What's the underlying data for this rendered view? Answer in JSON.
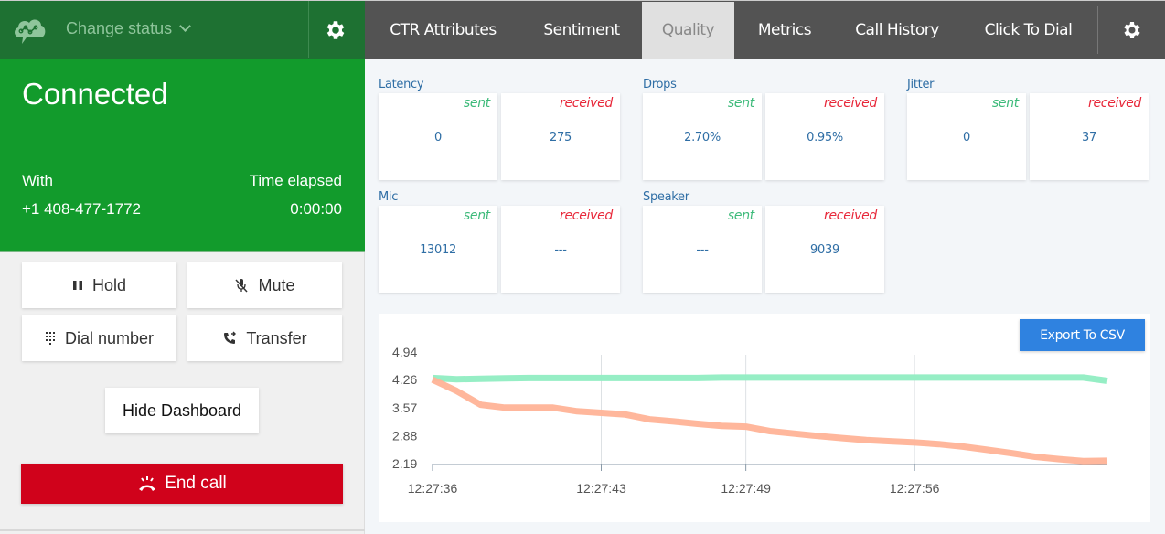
{
  "left": {
    "status_dropdown": "Change status",
    "connection": {
      "title": "Connected",
      "with_label": "With",
      "phone": "+1 408-477-1772",
      "elapsed_label": "Time elapsed",
      "elapsed": "0:00:00"
    },
    "buttons": {
      "hold": "Hold",
      "mute": "Mute",
      "dial": "Dial number",
      "transfer": "Transfer",
      "hide_dashboard": "Hide Dashboard",
      "end_call": "End call"
    },
    "colors": {
      "header": "#1e7132",
      "connected": "#129b2c",
      "end_call": "#d0021b"
    }
  },
  "tabs": [
    {
      "label": "CTR Attributes",
      "active": false
    },
    {
      "label": "Sentiment",
      "active": false
    },
    {
      "label": "Quality",
      "active": true
    },
    {
      "label": "Metrics",
      "active": false
    },
    {
      "label": "Call History",
      "active": false
    },
    {
      "label": "Click To Dial",
      "active": false
    }
  ],
  "metrics": {
    "sent_label": "sent",
    "received_label": "received",
    "groups": [
      {
        "title": "Latency",
        "sent": "0",
        "received": "275"
      },
      {
        "title": "Drops",
        "sent": "2.70%",
        "received": "0.95%"
      },
      {
        "title": "Jitter",
        "sent": "0",
        "received": "37"
      },
      {
        "title": "Mic",
        "sent": "13012",
        "received": "---"
      },
      {
        "title": "Speaker",
        "sent": "---",
        "received": "9039"
      }
    ]
  },
  "export_button": "Export To CSV",
  "chart_data": {
    "type": "line",
    "title": "",
    "xlabel": "",
    "ylabel": "",
    "ylim": [
      2.19,
      4.94
    ],
    "yticks": [
      "4.94",
      "4.26",
      "3.57",
      "2.88",
      "2.19"
    ],
    "xticks": [
      "12:27:36",
      "12:27:43",
      "12:27:49",
      "12:27:56"
    ],
    "x": [
      "12:27:36",
      "12:27:37",
      "12:27:38",
      "12:27:39",
      "12:27:40",
      "12:27:41",
      "12:27:42",
      "12:27:43",
      "12:27:44",
      "12:27:45",
      "12:27:46",
      "12:27:47",
      "12:27:48",
      "12:27:49",
      "12:27:50",
      "12:27:51",
      "12:27:52",
      "12:27:53",
      "12:27:54",
      "12:27:55",
      "12:27:56",
      "12:27:57",
      "12:27:58",
      "12:27:59",
      "12:28:00",
      "12:28:01",
      "12:28:02",
      "12:28:03",
      "12:28:04"
    ],
    "grid": "vertical",
    "legend": "none",
    "series": [
      {
        "name": "sent",
        "color": "#90edc2",
        "values": [
          4.3,
          4.27,
          4.28,
          4.29,
          4.3,
          4.3,
          4.3,
          4.3,
          4.3,
          4.3,
          4.3,
          4.3,
          4.31,
          4.31,
          4.31,
          4.31,
          4.31,
          4.31,
          4.31,
          4.31,
          4.31,
          4.31,
          4.31,
          4.31,
          4.31,
          4.31,
          4.31,
          4.31,
          4.23
        ]
      },
      {
        "name": "received",
        "color": "#ffb397",
        "values": [
          4.26,
          3.98,
          3.64,
          3.57,
          3.57,
          3.57,
          3.48,
          3.44,
          3.4,
          3.28,
          3.23,
          3.17,
          3.12,
          3.1,
          2.99,
          2.93,
          2.87,
          2.82,
          2.77,
          2.74,
          2.71,
          2.67,
          2.61,
          2.53,
          2.45,
          2.36,
          2.3,
          2.25,
          2.26
        ]
      }
    ]
  }
}
